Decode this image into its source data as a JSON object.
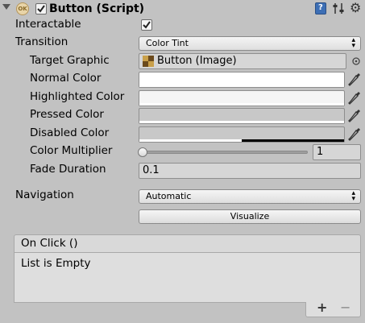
{
  "header": {
    "title": "Button (Script)",
    "enabled": true,
    "component_icon": "script-ok-icon",
    "help_icon": "help-book-icon",
    "preset_icon": "preset-sliders-icon",
    "settings_icon": "gear-icon"
  },
  "props": {
    "interactable_label": "Interactable",
    "interactable_checked": true,
    "transition_label": "Transition",
    "transition_value": "Color Tint",
    "target_graphic_label": "Target Graphic",
    "target_graphic_value": "Button (Image)",
    "normal_color_label": "Normal Color",
    "highlighted_color_label": "Highlighted Color",
    "pressed_color_label": "Pressed Color",
    "disabled_color_label": "Disabled Color",
    "color_multiplier_label": "Color Multiplier",
    "color_multiplier_value": "1",
    "fade_duration_label": "Fade Duration",
    "fade_duration_value": "0.1",
    "navigation_label": "Navigation",
    "navigation_value": "Automatic",
    "visualize_label": "Visualize"
  },
  "colors": {
    "normal": "#FFFFFF",
    "highlighted": "#F5F5F5",
    "pressed": "#C8C8C8",
    "disabled": "#C8C8C8"
  },
  "event": {
    "title": "On Click ()",
    "empty_text": "List is Empty",
    "add_label": "+",
    "remove_label": "−"
  }
}
